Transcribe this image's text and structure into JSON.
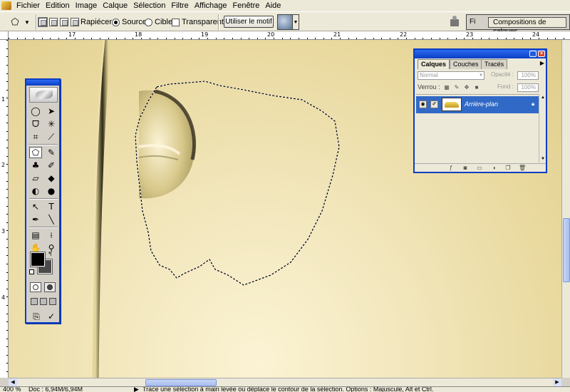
{
  "menu": [
    "Fichier",
    "Edition",
    "Image",
    "Calque",
    "Sélection",
    "Filtre",
    "Affichage",
    "Fenêtre",
    "Aide"
  ],
  "options": {
    "patch_label": "Rapiécer :",
    "source_label": "Source",
    "target_label": "Cible",
    "transparent_label": "Transparent",
    "use_pattern_label": "Utiliser le motif",
    "palette_well_fi": "Fi",
    "layer_comps_label": "Compositions de calques"
  },
  "ruler": {
    "top_numbers": [
      "17",
      "18",
      "19",
      "20",
      "21",
      "22",
      "23",
      "24"
    ],
    "left_numbers": [
      "1",
      "2",
      "3",
      "4"
    ]
  },
  "layers_panel": {
    "tabs": [
      "Calques",
      "Couches",
      "Tracés"
    ],
    "blend_mode": "Normal",
    "opacity_label": "Opacité :",
    "opacity_value": "100%",
    "lock_label": "Verrou :",
    "fill_label": "Fond :",
    "fill_value": "100%",
    "layer_name": "Arrière-plan"
  },
  "status": {
    "zoom": "400 %",
    "doc": "Doc : 6,94M/6,94M",
    "hint": "Trace une sélection à main levée ou déplace le contour de la sélection. Options : Majuscule, Alt et Ctrl."
  },
  "colors": {
    "foreground": "#000000",
    "background": "#4a4a4a",
    "selection_accent": "#3169c6",
    "palette_title": "#0a3ec4"
  }
}
